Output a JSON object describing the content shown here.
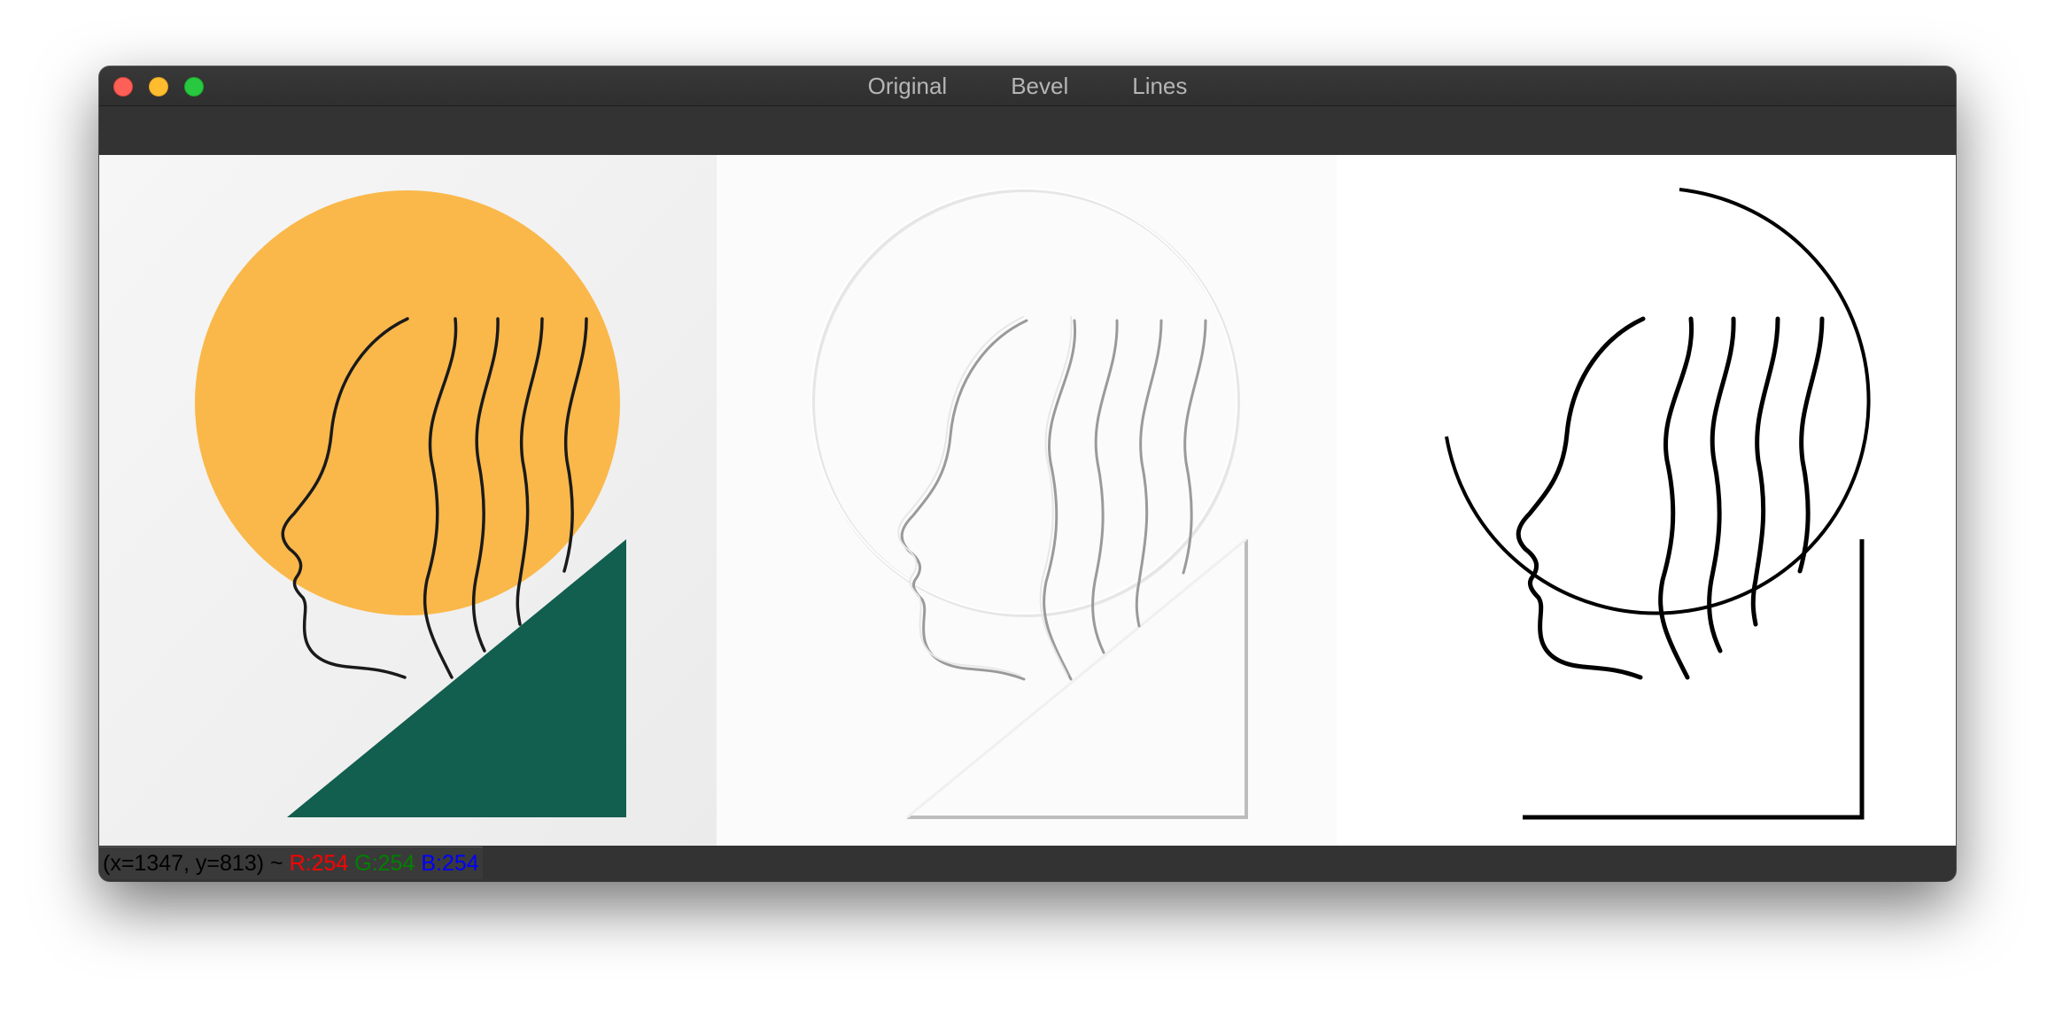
{
  "window": {
    "tabs": [
      {
        "label": "Original"
      },
      {
        "label": "Bevel"
      },
      {
        "label": "Lines"
      }
    ]
  },
  "status": {
    "coords": "(x=1347, y=813) ~",
    "r": "R:254",
    "g": "G:254",
    "b": "B:254"
  },
  "colors": {
    "sun": "#fab84a",
    "hill": "#125e4f",
    "ink": "#1a1a1a",
    "r_text": "#ff0000",
    "g_text": "#008000",
    "b_text": "#0000ff",
    "status_text": "#000000"
  }
}
